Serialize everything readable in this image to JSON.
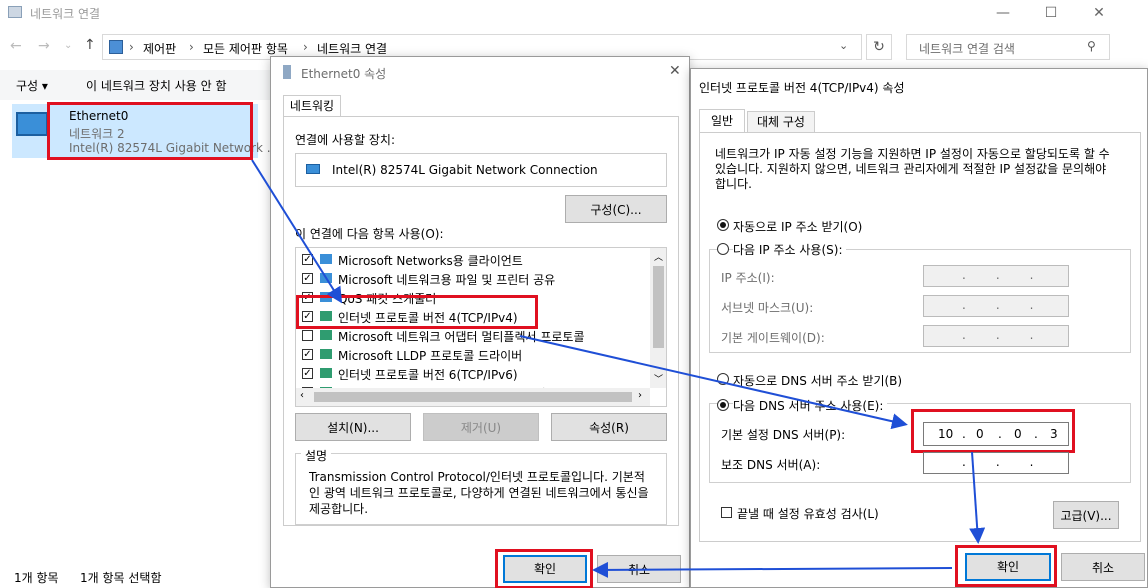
{
  "explorer": {
    "title": "네트워크 연결",
    "breadcrumb": [
      "제어판",
      "모든 제어판 항목",
      "네트워크 연결"
    ],
    "search_placeholder": "네트워크 연결 검색",
    "cmd_organize": "구성 ▾",
    "cmd_disable": "이 네트워크 장치 사용 안 함",
    "adapter": {
      "name": "Ethernet0",
      "network": "네트워크 2",
      "device": "Intel(R) 82574L Gigabit Network ..."
    },
    "status_count": "1개 항목",
    "status_selected": "1개 항목 선택함"
  },
  "eth_dialog": {
    "title": "Ethernet0 속성",
    "tab": "네트워킹",
    "connect_using": "연결에 사용할 장치:",
    "device": "Intel(R) 82574L Gigabit Network Connection",
    "configure": "구성(C)...",
    "items_label": "이 연결에 다음 항목 사용(O):",
    "items": [
      {
        "label": "Microsoft Networks용 클라이언트",
        "checked": true
      },
      {
        "label": "Microsoft 네트워크용 파일 및 프린터 공유",
        "checked": true
      },
      {
        "label": "QoS 패킷 스케줄러",
        "checked": true
      },
      {
        "label": "인터넷 프로토콜 버전 4(TCP/IPv4)",
        "checked": true
      },
      {
        "label": "Microsoft 네트워크 어댑터 멀티플렉서 프로토콜",
        "checked": false
      },
      {
        "label": "Microsoft LLDP 프로토콜 드라이버",
        "checked": true
      },
      {
        "label": "인터넷 프로토콜 버전 6(TCP/IPv6)",
        "checked": true
      },
      {
        "label": "Link-Layer Topology Discovery 응답기",
        "checked": true
      }
    ],
    "install": "설치(N)...",
    "uninstall": "제거(U)",
    "properties": "속성(R)",
    "desc_title": "설명",
    "description": "Transmission Control Protocol/인터넷 프로토콜입니다. 기본적인 광역 네트워크 프로토콜로, 다양하게 연결된 네트워크에서 통신을 제공합니다.",
    "ok": "확인",
    "cancel": "취소"
  },
  "ipv4_dialog": {
    "title": "인터넷 프로토콜 버전 4(TCP/IPv4) 속성",
    "tab_general": "일반",
    "tab_alt": "대체 구성",
    "intro": "네트워크가 IP 자동 설정 기능을 지원하면 IP 설정이 자동으로 할당되도록 할 수 있습니다. 지원하지 않으면, 네트워크 관리자에게 적절한 IP 설정값을 문의해야 합니다.",
    "auto_ip": "자동으로 IP 주소 받기(O)",
    "manual_ip": "다음 IP 주소 사용(S):",
    "ip_label": "IP 주소(I):",
    "subnet_label": "서브넷 마스크(U):",
    "gateway_label": "기본 게이트웨이(D):",
    "auto_dns": "자동으로 DNS 서버 주소 받기(B)",
    "manual_dns": "다음 DNS 서버 주소 사용(E):",
    "pref_dns_label": "기본 설정 DNS 서버(P):",
    "pref_dns": [
      "10",
      "0",
      "0",
      "3"
    ],
    "alt_dns_label": "보조 DNS 서버(A):",
    "validate": "끝낼 때 설정 유효성 검사(L)",
    "advanced": "고급(V)...",
    "ok": "확인",
    "cancel": "취소"
  },
  "colors": {
    "highlight": "#e01020",
    "arrow": "#1f4fd6",
    "accent": "#0078d7"
  }
}
